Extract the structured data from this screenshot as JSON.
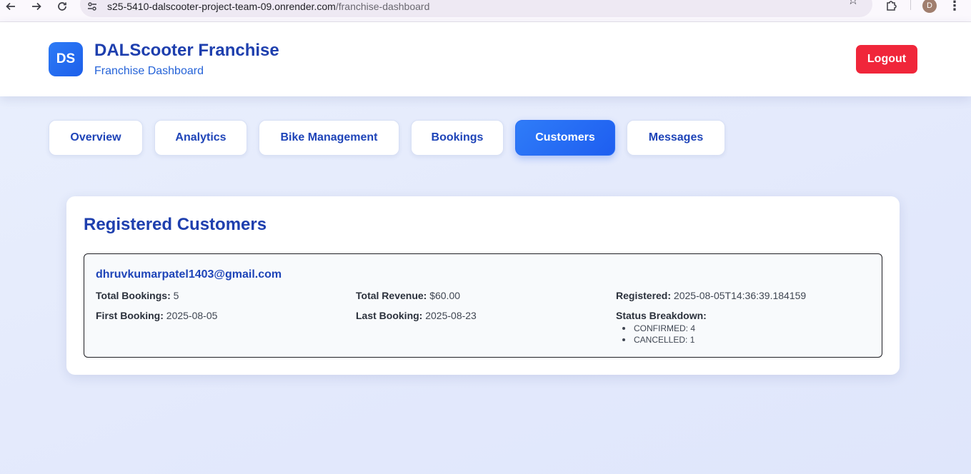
{
  "browser": {
    "url_host": "s25-5410-dalscooter-project-team-09.onrender.com",
    "url_path": "/franchise-dashboard",
    "profile_initial": "D",
    "icons": {
      "back": "arrow-left-icon",
      "forward": "arrow-right-icon",
      "reload": "reload-icon",
      "site_info": "tune-icon",
      "bookmark": "star-icon",
      "extensions": "puzzle-icon",
      "menu": "kebab-menu-icon"
    }
  },
  "header": {
    "logo_text": "DS",
    "title": "DALScooter Franchise",
    "subtitle": "Franchise Dashboard",
    "logout_label": "Logout"
  },
  "tabs": [
    {
      "label": "Overview",
      "active": false
    },
    {
      "label": "Analytics",
      "active": false
    },
    {
      "label": "Bike Management",
      "active": false
    },
    {
      "label": "Bookings",
      "active": false
    },
    {
      "label": "Customers",
      "active": true
    },
    {
      "label": "Messages",
      "active": false
    }
  ],
  "customers_section": {
    "title": "Registered Customers",
    "customers": [
      {
        "email": "dhruvkumarpatel1403@gmail.com",
        "total_bookings_label": "Total Bookings:",
        "total_bookings": "5",
        "total_revenue_label": "Total Revenue:",
        "total_revenue": "$60.00",
        "registered_label": "Registered:",
        "registered": "2025-08-05T14:36:39.184159",
        "first_booking_label": "First Booking:",
        "first_booking": "2025-08-05",
        "last_booking_label": "Last Booking:",
        "last_booking": "2025-08-23",
        "status_breakdown_label": "Status Breakdown:",
        "status_breakdown": [
          "CONFIRMED: 4",
          "CANCELLED: 1"
        ]
      }
    ]
  },
  "colors": {
    "primary": "#1e5ef0",
    "heading": "#1e3fae",
    "logout": "#f0263a",
    "page_bg": "#e6ecfc"
  }
}
